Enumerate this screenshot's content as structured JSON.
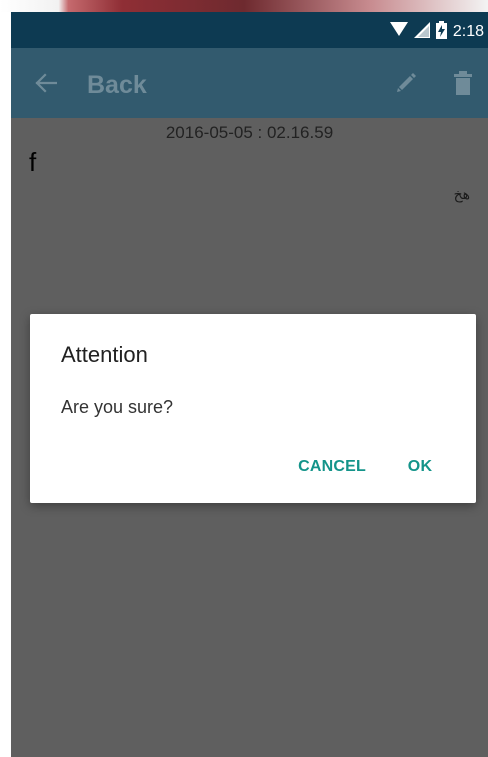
{
  "status_bar": {
    "time": "2:18",
    "icons": [
      "wifi-icon",
      "signal-icon",
      "battery-icon"
    ]
  },
  "app_bar": {
    "back_label": "Back",
    "icons": [
      "back-arrow-icon",
      "edit-icon",
      "delete-icon"
    ]
  },
  "note": {
    "date": "2016-05-05 : 02.16.59",
    "title": "f",
    "body": "هخ"
  },
  "dialog": {
    "title": "Attention",
    "message": "Are you sure?",
    "cancel_label": "CANCEL",
    "ok_label": "OK"
  },
  "colors": {
    "status_bar": "#0d3a52",
    "app_bar": "#325a6e",
    "scrim": "#5f5f5f",
    "accent": "#14948a"
  }
}
